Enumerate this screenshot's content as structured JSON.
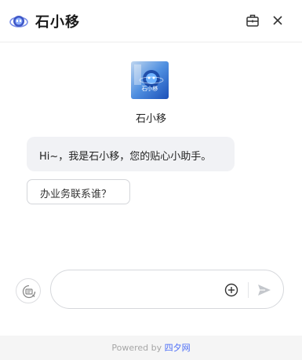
{
  "header": {
    "title": "石小移",
    "logo_icon": "ai-assistant-logo-icon",
    "icons": [
      "briefcase-icon",
      "close-icon"
    ]
  },
  "bot": {
    "avatar_text": "石小移",
    "name": "石小移"
  },
  "messages": {
    "greeting": "Hi~，我是石小移，您的贴心小助手。"
  },
  "suggestions": [
    {
      "label": "办业务联系谁？"
    }
  ],
  "composer": {
    "placeholder": "",
    "icons": [
      "quick-phrase-icon",
      "add-circle-icon",
      "send-icon"
    ]
  },
  "footer": {
    "powered_by": "Powered by",
    "brand": "四夕网"
  },
  "colors": {
    "accent": "#4a6cf7",
    "bubble_bg": "#f1f2f5",
    "footer_bg": "#f5f5f5"
  }
}
